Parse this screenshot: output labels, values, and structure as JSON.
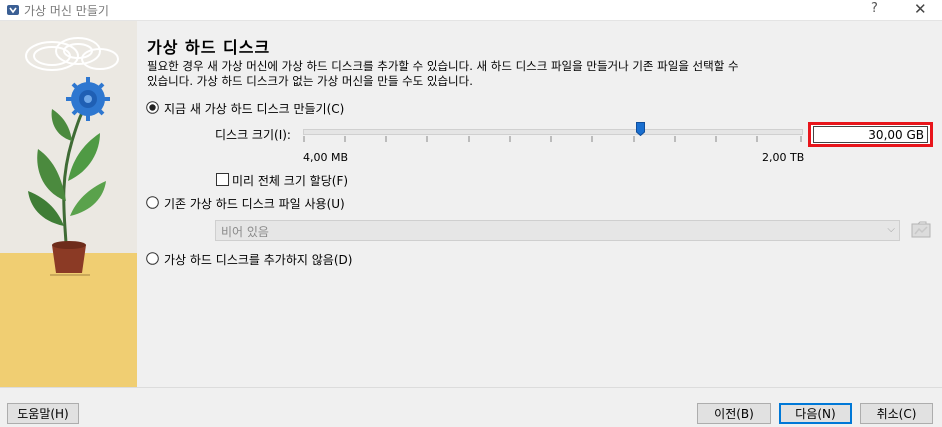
{
  "window": {
    "title": "가상 머신 만들기",
    "help_glyph": "?",
    "close_glyph": "✕"
  },
  "page": {
    "heading": "가상 하드 디스크",
    "description_line1": "필요한 경우 새 가상 머신에 가상 하드 디스크를 추가할 수 있습니다. 새 하드 디스크 파일을 만들거나 기존 파일을 선택할 수",
    "description_line2": "있습니다. 가상 하드 디스크가 없는 가상 머신을 만들 수도 있습니다."
  },
  "options": {
    "create_new": {
      "label": "지금 새 가상 하드 디스크 만들기(C)",
      "selected": true
    },
    "disk_size": {
      "label": "디스크 크기(I):",
      "value": "30,00 GB",
      "min_label": "4,00 MB",
      "max_label": "2,00 TB",
      "slider_fraction": 0.67
    },
    "preallocate": {
      "label": "미리 전체 크기 할당(F)",
      "checked": false
    },
    "use_existing": {
      "label": "기존 가상 하드 디스크 파일 사용(U)",
      "selected": false
    },
    "existing_combo": {
      "value": "비어 있음",
      "icon": "chevron-down-icon"
    },
    "no_disk": {
      "label": "가상 하드 디스크를 추가하지 않음(D)",
      "selected": false
    }
  },
  "buttons": {
    "help": "도움말(H)",
    "back": "이전(B)",
    "next": "다음(N)",
    "cancel": "취소(C)"
  },
  "colors": {
    "highlight_border": "#e8151b",
    "default_button_border": "#0078d7",
    "slider_thumb": "#1a6fd0",
    "side_floor": "#f0ce72",
    "flower": "#2e77d0"
  }
}
